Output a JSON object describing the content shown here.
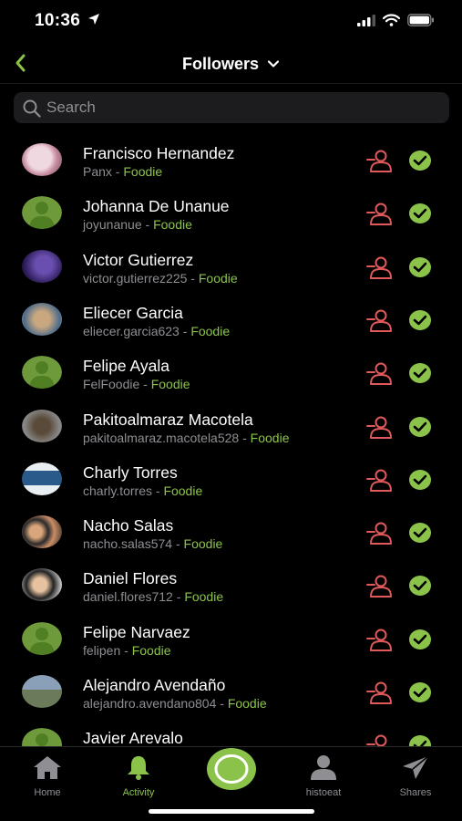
{
  "status_bar": {
    "time": "10:36"
  },
  "header": {
    "title": "Followers"
  },
  "search": {
    "placeholder": "Search"
  },
  "colors": {
    "accent": "#8bc34a",
    "unfollow": "#e05a5a",
    "muted": "#8e8e93"
  },
  "followers": [
    {
      "name": "Francisco Hernandez",
      "username": "Panx",
      "badge": "Foodie"
    },
    {
      "name": "Johanna De Unanue",
      "username": "joyunanue",
      "badge": "Foodie"
    },
    {
      "name": "Victor Gutierrez",
      "username": "victor.gutierrez225",
      "badge": "Foodie"
    },
    {
      "name": "Eliecer Garcia",
      "username": "eliecer.garcia623",
      "badge": "Foodie"
    },
    {
      "name": "Felipe Ayala",
      "username": "FelFoodie",
      "badge": "Foodie"
    },
    {
      "name": "Pakitoalmaraz Macotela",
      "username": "pakitoalmaraz.macotela528",
      "badge": "Foodie"
    },
    {
      "name": "Charly Torres",
      "username": "charly.torres",
      "badge": "Foodie"
    },
    {
      "name": "Nacho Salas",
      "username": "nacho.salas574",
      "badge": "Foodie"
    },
    {
      "name": "Daniel Flores",
      "username": "daniel.flores712",
      "badge": "Foodie"
    },
    {
      "name": "Felipe Narvaez",
      "username": "felipen",
      "badge": "Foodie"
    },
    {
      "name": "Alejandro Avendaño",
      "username": "alejandro.avendano804",
      "badge": "Foodie"
    },
    {
      "name": "Javier Arevalo",
      "username": "",
      "badge": ""
    }
  ],
  "tabbar": {
    "home": "Home",
    "activity": "Activity",
    "profile": "histoeat",
    "shares": "Shares"
  }
}
